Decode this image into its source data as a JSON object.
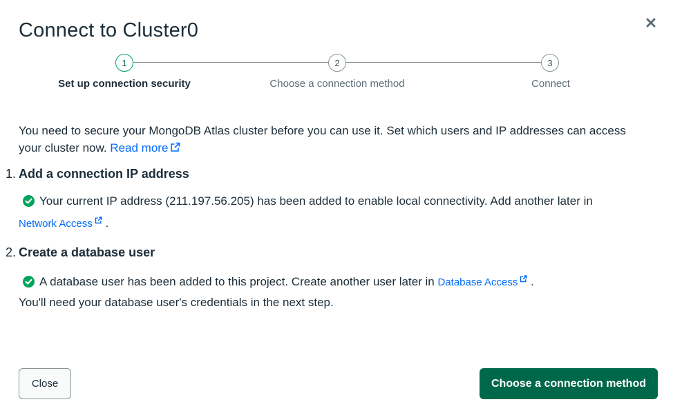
{
  "modal": {
    "title": "Connect to Cluster0"
  },
  "stepper": {
    "steps": [
      {
        "number": "1",
        "label": "Set up connection security",
        "active": true
      },
      {
        "number": "2",
        "label": "Choose a connection method",
        "active": false
      },
      {
        "number": "3",
        "label": "Connect",
        "active": false
      }
    ]
  },
  "intro": {
    "text": "You need to secure your MongoDB Atlas cluster before you can use it. Set which users and IP addresses can access your cluster now.",
    "link": "Read more"
  },
  "section_ip": {
    "number": "1.",
    "title": "Add a connection IP address",
    "status": "Your current IP address (211.197.56.205) has been added to enable local connectivity. Add another later in",
    "link": "Network Access",
    "suffix": "."
  },
  "section_user": {
    "number": "2.",
    "title": "Create a database user",
    "status": "A database user has been added to this project. Create another user later in",
    "link": "Database Access",
    "suffix": ".",
    "note": "You'll need your database user's credentials in the next step."
  },
  "footer": {
    "close_label": "Close",
    "primary_label": "Choose a connection method"
  },
  "colors": {
    "primary": "#00684a",
    "success": "#00a35c",
    "link": "#016bf8",
    "text": "#1c2d38"
  }
}
